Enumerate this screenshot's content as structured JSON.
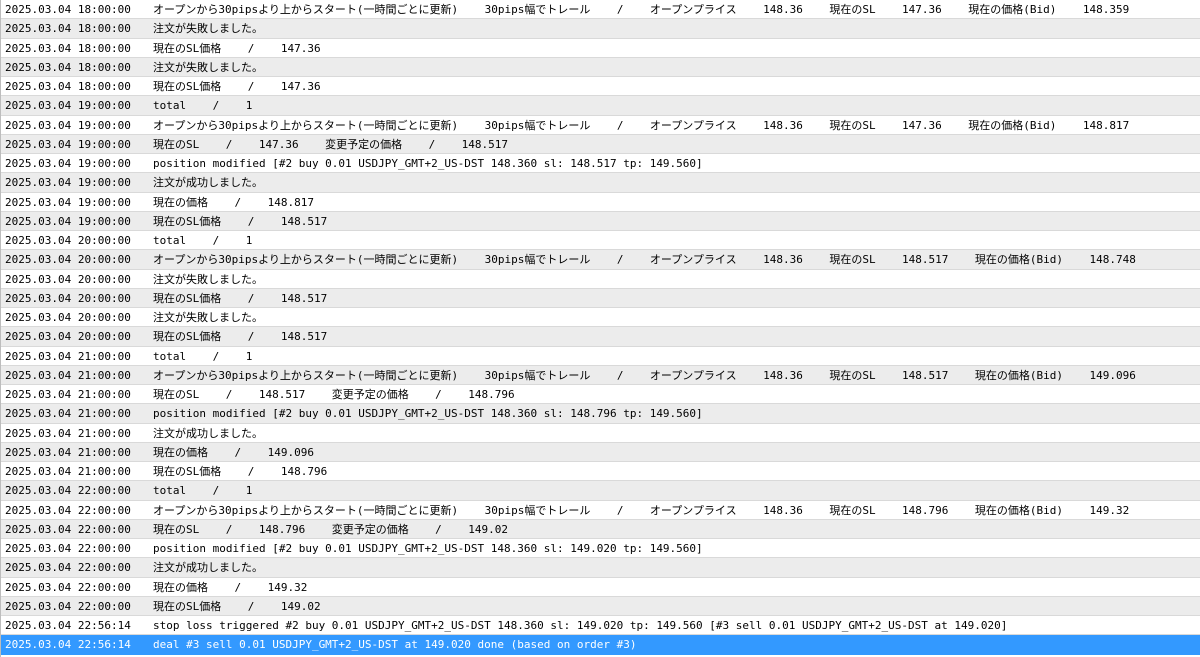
{
  "log": {
    "selected_index": 33,
    "rows": [
      {
        "time": "2025.03.04 18:00:00",
        "message": "オープンから30pipsより上からスタート(一時間ごとに更新)    30pips幅でトレール    /    オープンプライス    148.36    現在のSL    147.36    現在の価格(Bid)    148.359"
      },
      {
        "time": "2025.03.04 18:00:00",
        "message": "注文が失敗しました。"
      },
      {
        "time": "2025.03.04 18:00:00",
        "message": "現在のSL価格    /    147.36"
      },
      {
        "time": "2025.03.04 18:00:00",
        "message": "注文が失敗しました。"
      },
      {
        "time": "2025.03.04 18:00:00",
        "message": "現在のSL価格    /    147.36"
      },
      {
        "time": "2025.03.04 19:00:00",
        "message": "total    /    1"
      },
      {
        "time": "2025.03.04 19:00:00",
        "message": "オープンから30pipsより上からスタート(一時間ごとに更新)    30pips幅でトレール    /    オープンプライス    148.36    現在のSL    147.36    現在の価格(Bid)    148.817"
      },
      {
        "time": "2025.03.04 19:00:00",
        "message": "現在のSL    /    147.36    変更予定の価格    /    148.517"
      },
      {
        "time": "2025.03.04 19:00:00",
        "message": "position modified [#2 buy 0.01 USDJPY_GMT+2_US-DST 148.360 sl: 148.517 tp: 149.560]"
      },
      {
        "time": "2025.03.04 19:00:00",
        "message": "注文が成功しました。"
      },
      {
        "time": "2025.03.04 19:00:00",
        "message": "現在の価格    /    148.817"
      },
      {
        "time": "2025.03.04 19:00:00",
        "message": "現在のSL価格    /    148.517"
      },
      {
        "time": "2025.03.04 20:00:00",
        "message": "total    /    1"
      },
      {
        "time": "2025.03.04 20:00:00",
        "message": "オープンから30pipsより上からスタート(一時間ごとに更新)    30pips幅でトレール    /    オープンプライス    148.36    現在のSL    148.517    現在の価格(Bid)    148.748"
      },
      {
        "time": "2025.03.04 20:00:00",
        "message": "注文が失敗しました。"
      },
      {
        "time": "2025.03.04 20:00:00",
        "message": "現在のSL価格    /    148.517"
      },
      {
        "time": "2025.03.04 20:00:00",
        "message": "注文が失敗しました。"
      },
      {
        "time": "2025.03.04 20:00:00",
        "message": "現在のSL価格    /    148.517"
      },
      {
        "time": "2025.03.04 21:00:00",
        "message": "total    /    1"
      },
      {
        "time": "2025.03.04 21:00:00",
        "message": "オープンから30pipsより上からスタート(一時間ごとに更新)    30pips幅でトレール    /    オープンプライス    148.36    現在のSL    148.517    現在の価格(Bid)    149.096"
      },
      {
        "time": "2025.03.04 21:00:00",
        "message": "現在のSL    /    148.517    変更予定の価格    /    148.796"
      },
      {
        "time": "2025.03.04 21:00:00",
        "message": "position modified [#2 buy 0.01 USDJPY_GMT+2_US-DST 148.360 sl: 148.796 tp: 149.560]"
      },
      {
        "time": "2025.03.04 21:00:00",
        "message": "注文が成功しました。"
      },
      {
        "time": "2025.03.04 21:00:00",
        "message": "現在の価格    /    149.096"
      },
      {
        "time": "2025.03.04 21:00:00",
        "message": "現在のSL価格    /    148.796"
      },
      {
        "time": "2025.03.04 22:00:00",
        "message": "total    /    1"
      },
      {
        "time": "2025.03.04 22:00:00",
        "message": "オープンから30pipsより上からスタート(一時間ごとに更新)    30pips幅でトレール    /    オープンプライス    148.36    現在のSL    148.796    現在の価格(Bid)    149.32"
      },
      {
        "time": "2025.03.04 22:00:00",
        "message": "現在のSL    /    148.796    変更予定の価格    /    149.02"
      },
      {
        "time": "2025.03.04 22:00:00",
        "message": "position modified [#2 buy 0.01 USDJPY_GMT+2_US-DST 148.360 sl: 149.020 tp: 149.560]"
      },
      {
        "time": "2025.03.04 22:00:00",
        "message": "注文が成功しました。"
      },
      {
        "time": "2025.03.04 22:00:00",
        "message": "現在の価格    /    149.32"
      },
      {
        "time": "2025.03.04 22:00:00",
        "message": "現在のSL価格    /    149.02"
      },
      {
        "time": "2025.03.04 22:56:14",
        "message": "stop loss triggered #2 buy 0.01 USDJPY_GMT+2_US-DST 148.360 sl: 149.020 tp: 149.560 [#3 sell 0.01 USDJPY_GMT+2_US-DST at 149.020]"
      },
      {
        "time": "2025.03.04 22:56:14",
        "message": "deal #3 sell 0.01 USDJPY_GMT+2_US-DST at 149.020 done (based on order #3)"
      }
    ]
  }
}
